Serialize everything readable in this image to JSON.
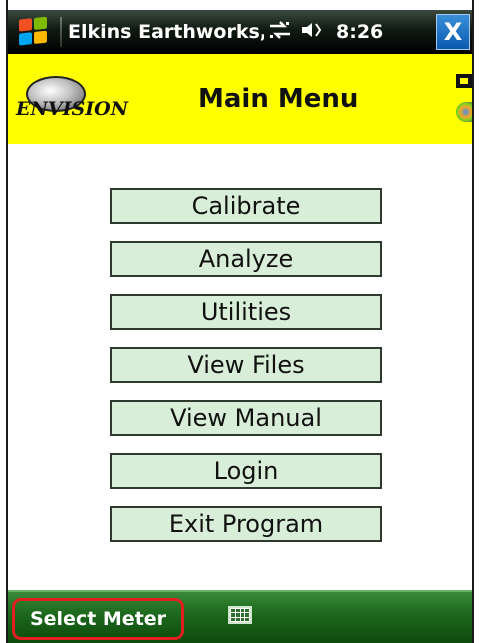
{
  "titlebar": {
    "title": "Elkins Earthworks, I",
    "time": "8:26",
    "start_icon": "windows-flag-icon",
    "connectivity_icon": "sync-arrows-icon",
    "volume_icon": "speaker-icon",
    "close_label": "X"
  },
  "header": {
    "logo_text": "ENVISION",
    "page_title": "Main Menu",
    "background_color": "#ffff00"
  },
  "menu": {
    "items": [
      {
        "label": "Calibrate"
      },
      {
        "label": "Analyze"
      },
      {
        "label": "Utilities"
      },
      {
        "label": "View Files"
      },
      {
        "label": "View Manual"
      },
      {
        "label": "Login"
      },
      {
        "label": "Exit Program"
      }
    ],
    "button_color": "#d8eed8"
  },
  "bottombar": {
    "left_softkey": "Select Meter",
    "keyboard_icon": "keyboard-icon",
    "highlight_color": "#e02020"
  }
}
